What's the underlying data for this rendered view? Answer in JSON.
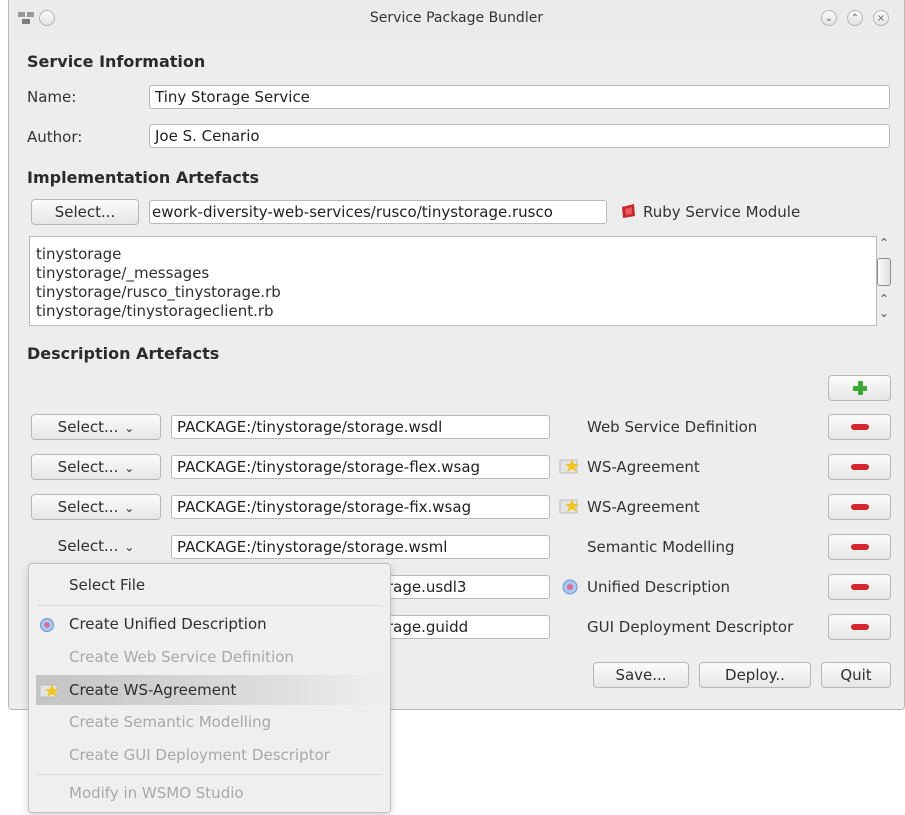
{
  "window": {
    "title": "Service Package Bundler"
  },
  "service_info": {
    "title": "Service Information",
    "name_label": "Name:",
    "name_value": "Tiny Storage Service",
    "author_label": "Author:",
    "author_value": "Joe S. Cenario"
  },
  "impl": {
    "title": "Implementation Artefacts",
    "select_label": "Select...",
    "path": "ework-diversity-web-services/rusco/tinystorage.rusco",
    "module_label": "Ruby Service Module",
    "files": [
      "tinystorage",
      "tinystorage/_messages",
      "tinystorage/rusco_tinystorage.rb",
      "tinystorage/tinystorageclient.rb"
    ]
  },
  "desc": {
    "title": "Description Artefacts",
    "select_label": "Select...",
    "rows": [
      {
        "path": "PACKAGE:/tinystorage/storage.wsdl",
        "type": "Web Service Definition",
        "icon": ""
      },
      {
        "path": "PACKAGE:/tinystorage/storage-flex.wsag",
        "type": "WS-Agreement",
        "icon": "star-document-icon"
      },
      {
        "path": "PACKAGE:/tinystorage/storage-fix.wsag",
        "type": "WS-Agreement",
        "icon": "star-document-icon"
      },
      {
        "path": "PACKAGE:/tinystorage/storage.wsml",
        "type": "Semantic Modelling",
        "icon": ""
      },
      {
        "path": "rage.usdl3",
        "type": "Unified Description",
        "icon": "usdl-globe-icon"
      },
      {
        "path": "rage.guidd",
        "type": "GUI Deployment Descriptor",
        "icon": ""
      }
    ]
  },
  "actions": {
    "save": "Save...",
    "deploy": "Deploy..",
    "quit": "Quit"
  },
  "menu": {
    "select_file": "Select File",
    "create_unified": "Create Unified Description",
    "create_wsdl": "Create Web Service Definition",
    "create_wsag": "Create WS-Agreement",
    "create_semantic": "Create Semantic Modelling",
    "create_gui": "Create GUI Deployment Descriptor",
    "modify_wsmo": "Modify in WSMO Studio"
  },
  "colors": {
    "remove": "#d3262d",
    "add": "#3ea835",
    "window_bg": "#eeeded"
  }
}
